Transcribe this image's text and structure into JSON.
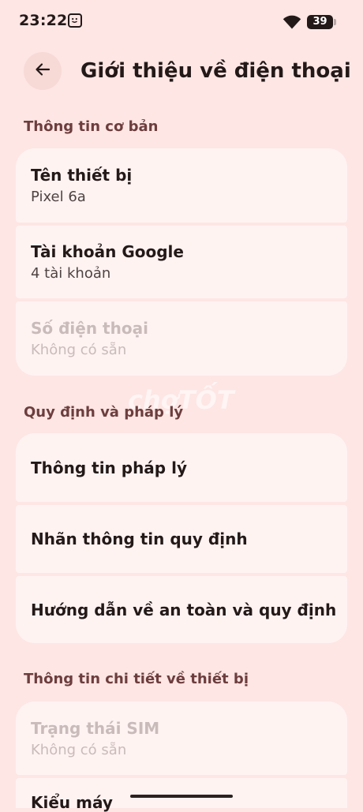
{
  "status_bar": {
    "time": "23:22",
    "battery": "39"
  },
  "header": {
    "title": "Giới thiệu về điện thoại"
  },
  "sections": [
    {
      "header": "Thông tin cơ bản",
      "items": [
        {
          "title": "Tên thiết bị",
          "subtitle": "Pixel 6a",
          "enabled": true
        },
        {
          "title": "Tài khoản Google",
          "subtitle": "4 tài khoản",
          "enabled": true
        },
        {
          "title": "Số điện thoại",
          "subtitle": "Không có sẵn",
          "enabled": false
        }
      ]
    },
    {
      "header": "Quy định và pháp lý",
      "items": [
        {
          "title": "Thông tin pháp lý",
          "enabled": true
        },
        {
          "title": "Nhãn thông tin quy định",
          "enabled": true
        },
        {
          "title": "Hướng dẫn về an toàn và quy định",
          "enabled": true
        }
      ]
    },
    {
      "header": "Thông tin chi tiết về thiết bị",
      "items": [
        {
          "title": "Trạng thái SIM",
          "subtitle": "Không có sẵn",
          "enabled": false
        },
        {
          "title": "Kiểu máy",
          "enabled": true
        }
      ]
    }
  ],
  "watermark": "chợTỐT",
  "colors": {
    "background": "#fde6e4",
    "card": "#fff3f2",
    "section_header": "#6d3d3d",
    "disabled_text": "#c8bbba"
  }
}
